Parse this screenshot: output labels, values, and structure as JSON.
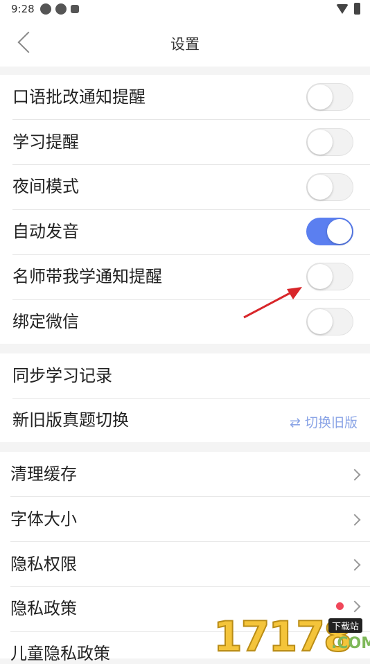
{
  "status": {
    "time": "9:28"
  },
  "nav": {
    "title": "设置"
  },
  "toggles": [
    {
      "label": "口语批改通知提醒",
      "on": false
    },
    {
      "label": "学习提醒",
      "on": false
    },
    {
      "label": "夜间模式",
      "on": false
    },
    {
      "label": "自动发音",
      "on": true
    },
    {
      "label": "名师带我学通知提醒",
      "on": false
    },
    {
      "label": "绑定微信",
      "on": false
    }
  ],
  "sync": {
    "records_label": "同步学习记录",
    "version_label": "新旧版真题切换",
    "switch_text": "⇄ 切换旧版"
  },
  "menu": [
    {
      "label": "清理缓存"
    },
    {
      "label": "字体大小"
    },
    {
      "label": "隐私权限"
    },
    {
      "label": "隐私政策"
    },
    {
      "label": "儿童隐私政策"
    }
  ],
  "watermark": {
    "digits": "17178",
    "badge": "下载站",
    "domain": ".COM"
  },
  "colors": {
    "toggle_on": "#5b7ff0",
    "accent_text": "#8aa4e6",
    "badge_dot": "#f0475a"
  }
}
